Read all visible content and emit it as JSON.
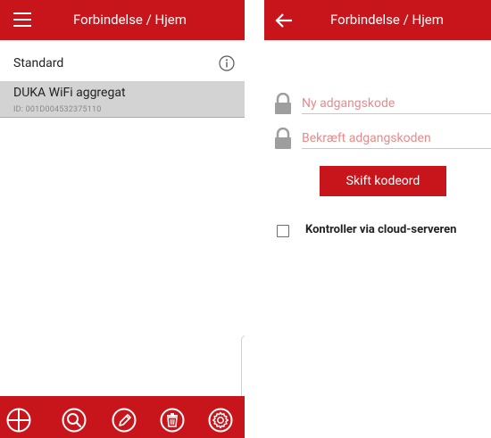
{
  "left_screen": {
    "header": {
      "title": "Forbindelse / Hjem",
      "menu_icon": "hamburger-menu-icon"
    },
    "section_label": "Standard",
    "info_icon": "info-icon",
    "devices": [
      {
        "name": "DUKA WiFi aggregat",
        "id": "ID: 001D004532375110"
      }
    ],
    "bottom_bar": {
      "icons": [
        "add-icon",
        "search-icon",
        "edit-icon",
        "delete-icon",
        "settings-icon"
      ]
    }
  },
  "right_screen": {
    "header": {
      "title": "Forbindelse / Hjem",
      "back_icon": "back-arrow-icon"
    },
    "new_password_placeholder": "Ny adgangskode",
    "confirm_password_placeholder": "Bekræft adgangskoden",
    "change_button_label": "Skift kodeord",
    "cloud_checkbox": {
      "label": "Kontroller via cloud-serveren",
      "checked": false
    }
  },
  "colors": {
    "accent": "#c8151b",
    "selected_row": "#d3d3d3",
    "placeholder": "#e88a8a"
  }
}
